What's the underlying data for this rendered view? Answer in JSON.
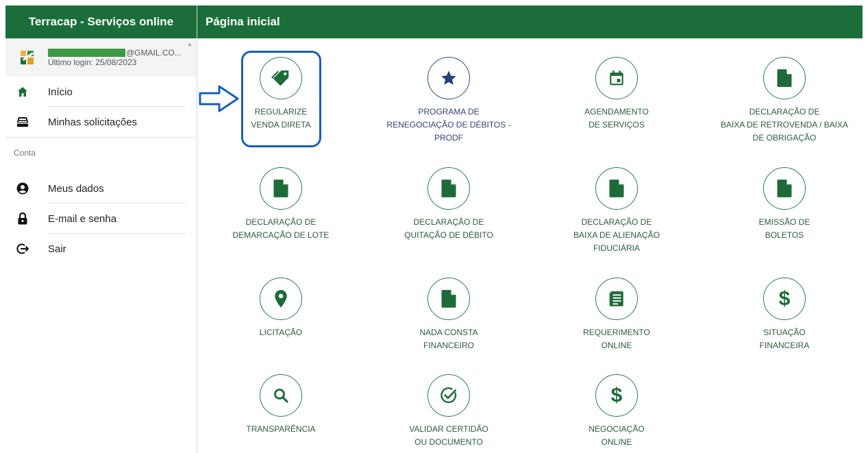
{
  "sidebar": {
    "title": "Terracap - Serviços online",
    "user": {
      "email_suffix": "@GMAIL.CO...",
      "last_login": "Último login: 25/08/2023"
    },
    "nav": [
      {
        "label": "Início",
        "icon": "home-icon"
      },
      {
        "label": "Minhas solicitações",
        "icon": "inbox-icon"
      }
    ],
    "section_label": "Conta",
    "account": [
      {
        "label": "Meus dados",
        "icon": "user-icon"
      },
      {
        "label": "E-mail e senha",
        "icon": "lock-icon"
      },
      {
        "label": "Sair",
        "icon": "logout-icon"
      }
    ]
  },
  "main": {
    "title": "Página inicial",
    "tiles": [
      {
        "label": "REGULARIZE\nVENDA DIRETA",
        "icon": "tag-icon"
      },
      {
        "label": "PROGRAMA DE\nRENEGOCIAÇÃO DE DÉBITOS -\nPRODF",
        "icon": "star-icon"
      },
      {
        "label": "AGENDAMENTO\nDE SERVIÇOS",
        "icon": "calendar-icon"
      },
      {
        "label": "DECLARAÇÃO DE\nBAIXA DE RETROVENDA / BAIXA\nDE OBRIGAÇÃO",
        "icon": "file-icon"
      },
      {
        "label": "DECLARAÇÃO DE\nDEMARCAÇÃO DE LOTE",
        "icon": "file-icon"
      },
      {
        "label": "DECLARAÇÃO DE\nQUITAÇÃO DE DÉBITO",
        "icon": "file-icon"
      },
      {
        "label": "DECLARAÇÃO DE\nBAIXA DE ALIENAÇÃO\nFIDUCIÁRIA",
        "icon": "file-icon"
      },
      {
        "label": "EMISSÃO DE\nBOLETOS",
        "icon": "file-icon"
      },
      {
        "label": "LICITAÇÃO",
        "icon": "location-pin-icon"
      },
      {
        "label": "NADA CONSTA\nFINANCEIRO",
        "icon": "file-icon"
      },
      {
        "label": "REQUERIMENTO\nONLINE",
        "icon": "document-list-icon"
      },
      {
        "label": "SITUAÇÃO\nFINANCEIRA",
        "icon": "dollar-icon"
      },
      {
        "label": "TRANSPARÊNCIA",
        "icon": "search-icon"
      },
      {
        "label": "VALIDAR CERTIDÃO\nOU DOCUMENTO",
        "icon": "check-circle-icon"
      },
      {
        "label": "NEGOCIAÇÃO\nONLINE",
        "icon": "dollar-icon"
      }
    ]
  },
  "colors": {
    "brand_green": "#1b6e3a",
    "icon_green": "#1e6b39",
    "highlight_blue": "#1a5fb4",
    "star_blue": "#27407a"
  }
}
